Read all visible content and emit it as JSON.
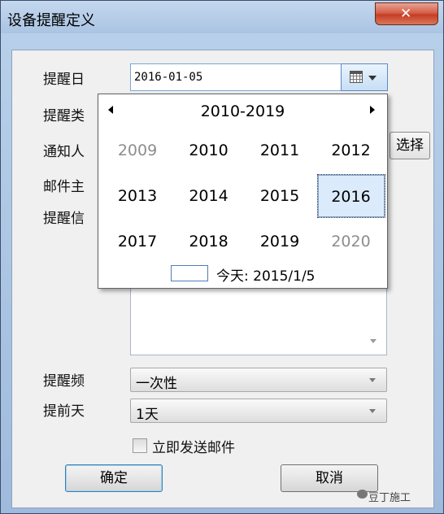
{
  "window": {
    "title": "设备提醒定义",
    "close_glyph": "✕"
  },
  "form": {
    "remind_date_label": "提醒日",
    "remind_date_value": "2016-01-05",
    "remind_type_label": "提醒类",
    "notify_label": "通知人",
    "choose_label": "选择",
    "mail_subject_label": "邮件主",
    "remind_info_label": "提醒信",
    "frequency_label": "提醒频",
    "frequency_value": "一次性",
    "days_before_label": "提前天",
    "days_before_value": "1天",
    "send_now_label": "立即发送邮件",
    "send_now_checked": false,
    "ok_label": "确定",
    "cancel_label": "取消"
  },
  "calendar": {
    "range_title": "2010-2019",
    "years": [
      {
        "label": "2009",
        "outside": true
      },
      {
        "label": "2010",
        "outside": false
      },
      {
        "label": "2011",
        "outside": false
      },
      {
        "label": "2012",
        "outside": false
      },
      {
        "label": "2013",
        "outside": false
      },
      {
        "label": "2014",
        "outside": false
      },
      {
        "label": "2015",
        "outside": false
      },
      {
        "label": "2016",
        "outside": false,
        "selected": true
      },
      {
        "label": "2017",
        "outside": false
      },
      {
        "label": "2018",
        "outside": false
      },
      {
        "label": "2019",
        "outside": false
      },
      {
        "label": "2020",
        "outside": true
      }
    ],
    "today_text": "今天: 2015/1/5"
  },
  "watermark": {
    "text": "豆丁施工"
  }
}
